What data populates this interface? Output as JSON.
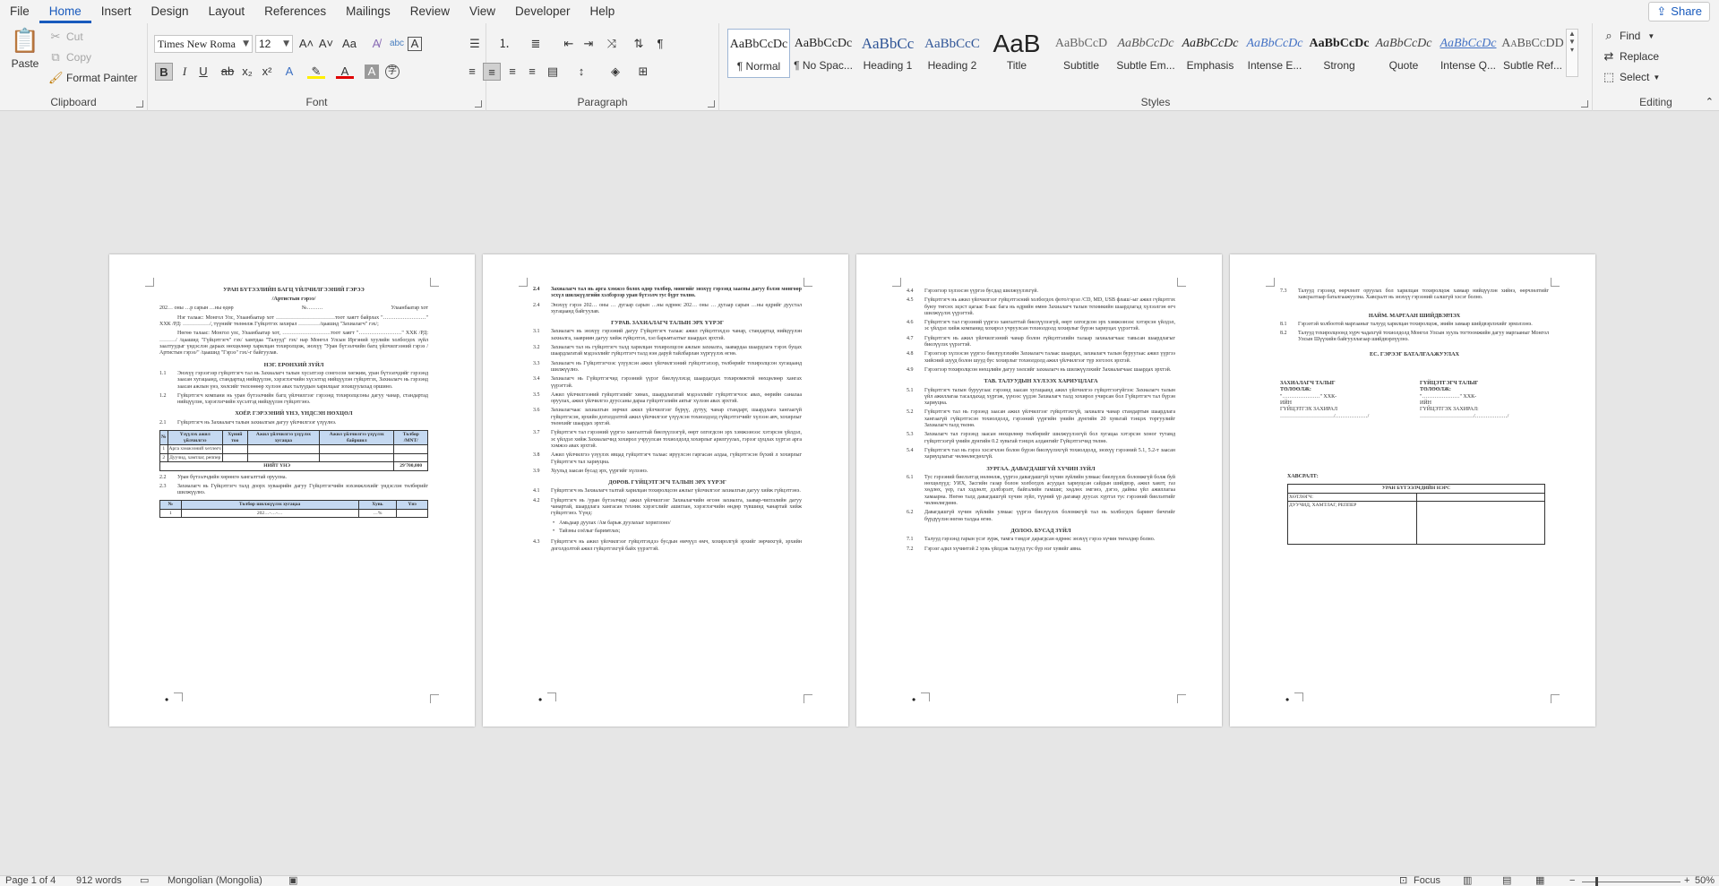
{
  "menu": {
    "tabs": [
      "File",
      "Home",
      "Insert",
      "Design",
      "Layout",
      "References",
      "Mailings",
      "Review",
      "View",
      "Developer",
      "Help"
    ],
    "active": "Home",
    "share_label": "Share"
  },
  "ribbon": {
    "clipboard": {
      "label": "Clipboard",
      "paste": "Paste",
      "cut": "Cut",
      "copy": "Copy",
      "format_painter": "Format Painter"
    },
    "font": {
      "label": "Font",
      "font_name": "Times New Roma",
      "font_size": "12"
    },
    "paragraph": {
      "label": "Paragraph"
    },
    "styles": {
      "label": "Styles",
      "items": [
        {
          "sample": "AaBbCcDc",
          "name": "¶ Normal"
        },
        {
          "sample": "AaBbCcDc",
          "name": "¶ No Spac..."
        },
        {
          "sample": "AaBbCc",
          "name": "Heading 1"
        },
        {
          "sample": "AaBbCcC",
          "name": "Heading 2"
        },
        {
          "sample": "AaB",
          "name": "Title"
        },
        {
          "sample": "AaBbCcD",
          "name": "Subtitle"
        },
        {
          "sample": "AaBbCcDc",
          "name": "Subtle Em..."
        },
        {
          "sample": "AaBbCcDc",
          "name": "Emphasis"
        },
        {
          "sample": "AaBbCcDc",
          "name": "Intense E..."
        },
        {
          "sample": "AaBbCcDc",
          "name": "Strong"
        },
        {
          "sample": "AaBbCcDc",
          "name": "Quote"
        },
        {
          "sample": "AaBbCcDc",
          "name": "Intense Q..."
        },
        {
          "sample": "AaBbCcDD",
          "name": "Subtle Ref..."
        }
      ]
    },
    "editing": {
      "label": "Editing",
      "find": "Find",
      "replace": "Replace",
      "select": "Select"
    }
  },
  "pages": {
    "p1": {
      "title": "УРАН БҮТЭЭЛИЙН БАГЦ ҮЙЛЧИЛГЭЭНИЙ ГЭРЭЭ",
      "subtitle": "/Артистын гэрээ/",
      "dateline_left": "202… оны …р сарын …ны өдөр",
      "dateline_mid": "№………",
      "dateline_right": "Улаанбаатар хот",
      "intro1": "Нэг талаас: Монгол Улс, Улаанбаатар хот ……………………………тоот хаягт байрлах \"……………………\" ХХК /РД: ……………/, түүнийг төлөөлж Гүйцэтгэх захирал …………/цаашид \"Захиалагч\" гэх/;",
      "intro2": "Нөгөө талаас: Монгол улс, Улаанбаатар хот, ………………………тоот хаягт \"……………………\" ХХК /РД: ………/ /цаашид \"Гүйцэтгэгч\" гэх/ хамтдаа \"Талууд\" гэх/ нар Монгол Улсын Иргэний хуулийн холбогдох зүйл заалтуудыг үндэслэн дараах нөхцөлөөр харилцан тохиролцож, энэхүү \"Уран бүтээлчийн багц үйлчилгээний гэрээ /Артистын гэрээ/\" /цаашид \"Гэрээ\" гэх/-г байгуулав.",
      "h1": "НЭГ. ЕРӨНХИЙ ЗҮЙЛ",
      "c11n": "1.1",
      "c11": "Энэхүү гэрээгээр гүйцэтгэгч тал нь Захиалагч талын хүсэлтээр сонгосон хөгжим, уран бүтээлчдийг гэрээнд заасан хугацаанд, стандартад нийцүүлэн, хэрэглэгчийн хүсэлтэд нийцүүлэн гүйцэтгэх, Захиалагч нь гэрээнд заасан ажлын үнэ, хөлсийг төлсөнөөр хүлээн авах талуудын харилцааг зохицуулахад оршино.",
      "c12n": "1.2",
      "c12": "Гүйцэтгэгч компани нь уран бүтээлчийн багц үйлчилгээг гэрээнд тохиролцсоны дагуу чанар, стандартад нийцүүлэн, хэрэглэгчийн хүсэлтэд нийцүүлэн гүйцэтгэнэ.",
      "h2": "ХОЁР. ГЭРЭЭНИЙ ҮНЭ, ҮНДСЭН НӨХЦӨЛ",
      "c21n": "2.1",
      "c21": "Гүйцэтгэгч нь Захиалагч талын захиалгын дагуу үйлчилгээг үзүүлнэ.",
      "table": {
        "headers": [
          "№",
          "Үзүүлэх ажил үйлчилгээ",
          "Хүний тоо",
          "Ажил үйлчилгээ үзүүлэх хугацаа",
          "Ажил үйлчилгээ үзүүлэх байршил",
          "Төлбөр /MNT/"
        ],
        "rows": [
          [
            "1",
            "Арга хэмжээний хөтлөгч",
            "",
            "",
            "",
            ""
          ],
          [
            "2",
            "Дуучид, хамтлаг, реппер",
            "",
            "",
            "",
            ""
          ]
        ],
        "total_label": "НИЙТ ҮНЭ",
        "total_value": "29'700,000"
      },
      "c22n": "2.2",
      "c22": "Уран бүтээлчдийн хөрөнгө хангалттай оруулна.",
      "c23n": "2.3",
      "c23": "Захиалагч нь Гүйцэтгэгч талд доорх хуваарийн дагуу Гүйцэтгэгчийн нэхэмжлэхийг үндэслэн төлбөрийг шилжүүлнэ.",
      "pay_table": {
        "headers": [
          "№",
          "Төлбөр шилжүүлэх хугацаа",
          "Хувь",
          "Үнэ"
        ],
        "rows": [
          [
            "1",
            "202…-…-…",
            "…%",
            ""
          ]
        ]
      }
    },
    "p2": {
      "c24n": "2.4",
      "c24": "Захиалагч тал нь арга хэмжээ болох өдөр төлбөр, мөнгийг энэхүү гэрээнд заасны дагуу бэлэн мөнгөөр эсхүл шилжүүлгийн хэлбэрээр уран бүтээлч тус бүрт төлнө.",
      "c25n": "2.4",
      "c25": "Энэхүү гэрээ 202… оны … дугаар сарын …ны өдрөөс 202… оны … дугаар сарын …ны өдрийг дуустал хугацаанд байгуулав.",
      "h3": "ГУРАВ. ЗАХИАЛАГЧ ТАЛЫН ЭРХ ҮҮРЭГ",
      "clauses": [
        {
          "n": "3.1",
          "t": "Захиалагч нь энэхүү гэрээний дагуу Гүйцэтгэгч талаас ажил гүйцэтгэхдээ чанар, стандартад нийцүүлэн захиалга, заавриин дагуу хийж гүйцэтгэх, хэл барьмталтыг шаардах эрхтэй."
        },
        {
          "n": "3.2",
          "t": "Захиалагч тал нь гүйцэтгэгч талд харилцан тохиролцсон ажлын захиалга, заавардаа шаардлага тэрэх буцах шаардлагатай мэдээллийг гүйцэтгэгч талд нэн даруй тайлбарлан хүргүүлэх өгнө."
        },
        {
          "n": "3.3",
          "t": "Захиалагч нь Гүйцэтгэгчээс үзүүлсэн ажил үйлчилгээний гүйцэтгэлээр, төлбөрийг тохиролцсон хугацаанд шилжүүлнэ."
        },
        {
          "n": "3.4",
          "t": "Захиалагч нь Гүйцэтгэгчид гэрээний үүрэг биелүүлэхэд шаардагдах тохиромжтой нөхцөлөөр хангах үүрэгтэй."
        },
        {
          "n": "3.5",
          "t": "Ажил үйлчилгээний гүйцэтгэлийг хянах, шаардлагатай мэдээллийг гүйцэтгэгчээс авах, өөрийн саналаа оруулах, ажил үйлчилгээ дууссаны дараа гүйцэтгэлийн актыг хүлээн авах эрхтэй."
        },
        {
          "n": "3.6",
          "t": "Захиалагчаас захиалгын зөрчил ажил үйлчилгээг бүрүү, дутуу, чанар стандарт, шаардлага хангаагүй гүйцэтгэсэн, эрхийн доголдолтой ажил үйлчилгээг үзүүлсэн тохиолдолд гүйцэтгэгчийг хүлээн авч, хохирлыг төлөхийг шаардах эрхтэй."
        },
        {
          "n": "3.7",
          "t": "Гүйцэтгэгч тал гэрээний үүргээ хангалттай биелүүлээгүй, өөрт олгогдсон эрх хэмжээнээс хэтэрсэн үйлдэл, эс үйлдэл хийж Захиалагчид хохирол учруулсан тохиолдолд хохирлыг арилгуулах, гэрээг цуцлах хүртэл арга хэмжээ авах эрхтэй."
        },
        {
          "n": "3.8",
          "t": "Ажил үйлчилгээ үзүүлэх явцад гүйцэтгэгч талаас ирүүлсэн гаргасан алдаа, гүйцэтгэсэн бүхий л хохирлыг Гүйцэтгэгч тал хариуцна."
        },
        {
          "n": "3.9",
          "t": "Хуульд заасан бусад эрх, үүргийг хүлээнэ."
        }
      ],
      "h4": "ДӨРӨВ. ГҮЙЦЭТГЭГЧ ТАЛЫН ЭРХ ҮҮРЭГ",
      "c41n": "4.1",
      "c41": "Гүйцэтгэгч нь Захиалагч талтай харилцан тохиролцсон ажлыг үйлчилгээг захиалгын дагуу хийж гүйцэтгэнэ.",
      "c42n": "4.2",
      "c42": "Гүйцэтгэгч нь /уран бүтээлчид/ ажил үйлчилгээг Захиалагчийн өгсөн захиалга, заавар-чиглэлийн дагуу чанартай, шаардлага хангасан техник хэрэгслийг ашиглан, хэрэглэгчийн өндөр түвшинд чанартай хийж гүйцэтгэнэ. Үүнд:",
      "bullets": [
        "Амьдаар дуулах /Ам барьж дуулахыг хориглоно/",
        "Тайзны соёлыг баримтлах;"
      ],
      "c43n": "4.3",
      "c43": "Гүйцэтгэгч нь ажил үйлчилгээг гүйцэтгэхдээ бусдын өмчүүл өмч, хохиролгүй эрхийг зөрчихгүй, эрхийн доголдолтой ажил гүйцэтгэхгүй байх үүрэгтэй."
    },
    "p3": {
      "clauses_a": [
        {
          "n": "4.4",
          "t": "Гэрээгээр хүлээсэн үүргээ бусдад шилжүүлэхгүй."
        },
        {
          "n": "4.5",
          "t": "Гүйцэтгэгч нь ажил үйлчилгээг гүйцэтгэсний холбогдох фото/гэрэл /CD, MD, USB флаш/-ыг ажил гүйцэтгэх буюу төгсөх эцэст цагаас 8-аас бага нь өдрийн өмнө Захиалагч талын техникийн шаардлагад хүлээлгэн өгч шилжүүлэх үүрэгтэй."
        },
        {
          "n": "4.6",
          "t": "Гүйцэтгэгч тал гэрээний үүргээ хангалттай биелүүлээгүй, өөрт олгогдсон эрх хэмжээнээс хэтэрсэн үйлдэл, эс үйлдэл хийж компанид хохирол учруулсан тохиолдолд хохирлыг бүрэн хариуцах үүрэгтэй."
        },
        {
          "n": "4.7",
          "t": "Гүйцэтгэгч нь ажил үйлчилгээний чанар болон гүйцэтгэлийн талаар захиалагчаас тавьсан шаардлагыг биелүүлэх үүрэгтэй."
        },
        {
          "n": "4.8",
          "t": "Гэрээгээр хүлээсэн үүргээ биелүүлэхийн Захиалагч талаас шаардах, захиалагч талын буруугаас ажил үүргээ хийсний шууд болон шууд бус хохирлыг тохиолдолд ажил үйлчилгээг түр зогсоох эрхтэй."
        },
        {
          "n": "4.9",
          "t": "Гэрээгээр тохиролцсон нөхцлийн дагуу хөлсийг захиалагч нь шилжүүлэхийг Захиалагчаас шаардах эрхтэй."
        }
      ],
      "h5": "ТАВ. ТАЛУУДЫН ХҮЛЭЭХ ХАРИУЦЛАГА",
      "clauses_b": [
        {
          "n": "5.1",
          "t": "Гүйцэтгэгч талын буруугаас гэрээнд заасан хугацаанд ажил үйлчилгээ гүйцэтгээгүйгээс Захиалагч талын үйл ажиллагаа тасалдахад хүргэж, үүнээс үүдэн Захиалагч талд хохирол учирсан бол Гүйцэтгэгч тал бүрэн хариуцна."
        },
        {
          "n": "5.2",
          "t": "Гүйцэтгэгч тал нь гэрээнд заасан ажил үйлчилгээг гүйцэтгэхгүй, захиалга чанар стандартын шаардлага хангаагүй гүйцэтгэсэн тохиолдолд, гэрээний үүргийн үнийн дүнгийн 20 хувьтай тэнцэх торгуулийг Захиалагч талд төлнө."
        },
        {
          "n": "5.3",
          "t": "Захиалагч тал гэрээнд заасан нөхцөлөөр төлбөрийг шилжүүлээгүй бол хугацаа хэтэрсэн хоног тутамд гүйцэтгээгүй үнийн дүнгийн 0.2 хувьтай тэнцэх алдангийг Гүйцэтгэгчид төлнө."
        },
        {
          "n": "5.4",
          "t": "Гүйцэтгэгч тал нь гэрээ хэсэгчлэн болон бүрэн биелүүлэхгүй тохиолдолд, энэхүү гэрээний 5.1, 5.2-т заасан хариуцлагыг чөлөөлөгдөхгүй."
        }
      ],
      "h6": "ЗУРГАА. ДАВАГДАШГҮЙ ХҮЧИН ЗҮЙЛ",
      "clauses_c": [
        {
          "n": "6.1",
          "t": "Тус гэрээний биелэлтэд нөлөөлж, үүргээ давагдашгүй хүчин зүйлийн улмаас биелүүлэх боломжгүй болж буй нөхцөлүүд: УИХ, Засгийн газар болон холбогдох асуудал хариуцсан сайдын шийдвэр, ажил хаялт, газ хөдлөх, үер, гал хэдлөлт, дэлбэрэлт, байгалийн гамшиг, хөдлөх эмгэнэ, дэгээ, дайны үйл ажиллагаа хамаарна. Нөгөө талд давагдашгүй хүчин зүйл, түүний үр дагавар дуусах хүртэл тус гэрээний биелэлтийг чөлөөлөгдөнө."
        },
        {
          "n": "6.2",
          "t": "Давагдашгүй хүчин зүйлийн улмаас үүргээ биелүүлэх боломжгүй тал нь холбогдох баримт бичгийг бүрдүүлэн нөгөө талдаа өгнө."
        }
      ],
      "h7": "ДОЛОО. БУСАД ЗҮЙЛ",
      "clauses_d": [
        {
          "n": "7.1",
          "t": "Талууд гэрээнд гарын үсэг зурж, тамга тэмдэг дарагдсан өдрөөс энэхүү гэрээ хүчин төгөлдөр болно."
        },
        {
          "n": "7.2",
          "t": "Гэрээг адил хүчинтэй 2 хувь үйлдэж талууд тус бүр нэг хувийг авна."
        }
      ]
    },
    "p4": {
      "c73n": "7.3",
      "c73": "Талууд гэрээнд өөрчлөлт оруулах бол харилцан тохиролцож хамаар нийцүүлэн хийнэ, өөрчлөлтийг хавсралтаар баталгаажуулна. Хавсралт нь энэхүү гэрээний салшгүй хэсэг болно.",
      "h8": "НАЙМ. МАРГААН ШИЙДВЭРЛЭХ",
      "c81n": "8.1",
      "c81": "Гэрээтэй холбоотой маргааныг талууд харилцан тохиролцож, эвийн замаар шийдвэрлэхийг эрмэлзэнэ.",
      "c82n": "8.2",
      "c82": "Талууд тохиролцоонд хүрч чадахгүй тохиолдолд Монгол Улсын хууль тогтоомжийн дагуу маргааныг Монгол Улсын Шүүхийн байгууллагаар шийдвэрлүүлнэ.",
      "h9": "ЕС. ГЭРЭЭГ БАТАЛГААЖУУЛАХ",
      "sig_left_title": "ЗАХИАЛАГЧ ТАЛЫГ ТӨЛӨӨЛЖ:",
      "sig_left_1": "\"…………………\" ХХК-ИЙН",
      "sig_left_2": "ГҮЙЦЭТГЭХ ЗАХИРАЛ",
      "sig_left_3": "…………………………/………………/",
      "sig_right_title": "ГҮЙЦЭТГЭГЧ ТАЛЫГ ТӨЛӨӨЛЖ:",
      "sig_right_1": "\"…………………\" ХХК-ИЙН",
      "sig_right_2": "ГҮЙЦЭТГЭХ ЗАХИРАЛ:",
      "sig_right_3": "…………………………/………………/",
      "annex_label": "ХАВСРАЛТ:",
      "annex_table_title": "УРАН БҮТЭЭЛЧДИЙН НЭРС",
      "annex_row1": "ХӨТЛӨГЧ:",
      "annex_row2": "ДУУЧИД, ХАМТЛАГ, РЕППЕР"
    }
  },
  "status": {
    "page": "Page 1 of 4",
    "words": "912 words",
    "language": "Mongolian (Mongolia)",
    "focus": "Focus",
    "zoom": "50%"
  }
}
